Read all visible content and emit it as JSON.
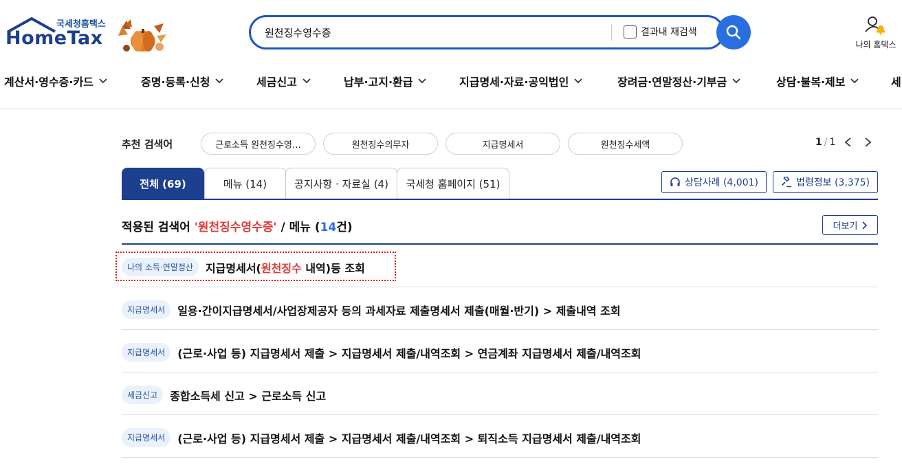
{
  "header": {
    "logo_small": "국세청홈택스",
    "logo_main": "HomeTax",
    "search_value": "원천징수영수증",
    "research_label": "결과내 재검색",
    "my_hometax_label": "나의 홈택스"
  },
  "nav": {
    "items": [
      {
        "label": "계산서·영수증·카드"
      },
      {
        "label": "증명·등록·신청"
      },
      {
        "label": "세금신고"
      },
      {
        "label": "납부·고지·환급"
      },
      {
        "label": "지급명세·자료·공익법인"
      },
      {
        "label": "장려금·연말정산·기부금"
      },
      {
        "label": "상담·불복·제보"
      },
      {
        "label": "세"
      }
    ]
  },
  "recommended": {
    "label": "추천 검색어",
    "chips": [
      "근로소득 원천징수영…",
      "원천징수의무자",
      "지급명세서",
      "원천징수세액"
    ],
    "page_current": "1",
    "page_sep": "/",
    "page_total": "1"
  },
  "tabs": [
    {
      "label": "전체 (69)"
    },
    {
      "label": "메뉴 (14)"
    },
    {
      "label": "공지사항 · 자료실 (4)"
    },
    {
      "label": "국세청 홈페이지 (51)"
    }
  ],
  "side_buttons": {
    "consult": "상담사례 (4,001)",
    "law": "법령정보 (3,375)"
  },
  "applied": {
    "prefix": "적용된 검색어 ",
    "term": "'원천징수영수증'",
    "middle": " / 메뉴 (",
    "count": "14",
    "suffix": "건)",
    "more_label": "더보기"
  },
  "results": [
    {
      "badge": "나의 소득·연말정산",
      "text_before": "지급명세서(",
      "text_hl": "원천징수",
      "text_after": " 내역)등 조회"
    },
    {
      "badge": "지급명세서",
      "text_before": "일용·간이지급명세서/사업장제공자 등의 과세자료 제출명세서 제출(매월·반기) > 제출내역 조회",
      "text_hl": "",
      "text_after": ""
    },
    {
      "badge": "지급명세서",
      "text_before": "(근로·사업 등) 지급명세서 제출 > 지급명세서 제출/내역조회 > 연금계좌 지급명세서 제출/내역조회",
      "text_hl": "",
      "text_after": ""
    },
    {
      "badge": "세금신고",
      "text_before": "종합소득세 신고 > 근로소득 신고",
      "text_hl": "",
      "text_after": ""
    },
    {
      "badge": "지급명세서",
      "text_before": "(근로·사업 등) 지급명세서 제출 > 지급명세서 제출/내역조회 > 퇴직소득 지급명세서 제출/내역조회",
      "text_hl": "",
      "text_after": ""
    }
  ],
  "colors": {
    "brand_navy": "#1c3f8f",
    "search_blue": "#2a6fe0",
    "highlight_red": "#e03a3a",
    "badge_bg": "#eaf1fb"
  }
}
